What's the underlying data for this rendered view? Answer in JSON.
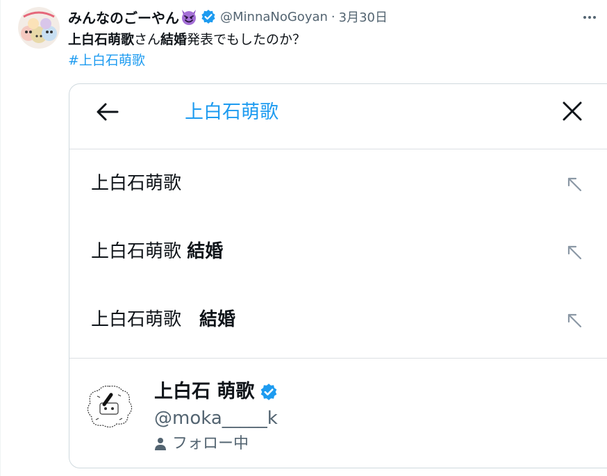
{
  "tweet": {
    "author": {
      "display_name": "みんなのごーやん",
      "handle": "@MinnaNoGoyan",
      "date": "3月30日"
    },
    "separator": "·",
    "text_segments": [
      {
        "text": "上白石萌歌",
        "bold": true
      },
      {
        "text": "さん",
        "bold": false
      },
      {
        "text": "結婚",
        "bold": true
      },
      {
        "text": "発表でもしたのか？",
        "bold": false
      }
    ],
    "hashtag": "#上白石萌歌"
  },
  "screenshot": {
    "search_query": "上白石萌歌",
    "suggestions": [
      {
        "text": "上白石萌歌",
        "bold": ""
      },
      {
        "text": "上白石萌歌 ",
        "bold": "結婚"
      },
      {
        "text": "上白石萌歌　",
        "bold": "結婚"
      }
    ],
    "user_result": {
      "name": "上白石 萌歌",
      "handle": "@moka_____k",
      "follow_status": "フォロー中"
    }
  },
  "colors": {
    "accent": "#1d9bf0",
    "text": "#0f1419",
    "secondary": "#536471",
    "border": "#cfd9de"
  }
}
